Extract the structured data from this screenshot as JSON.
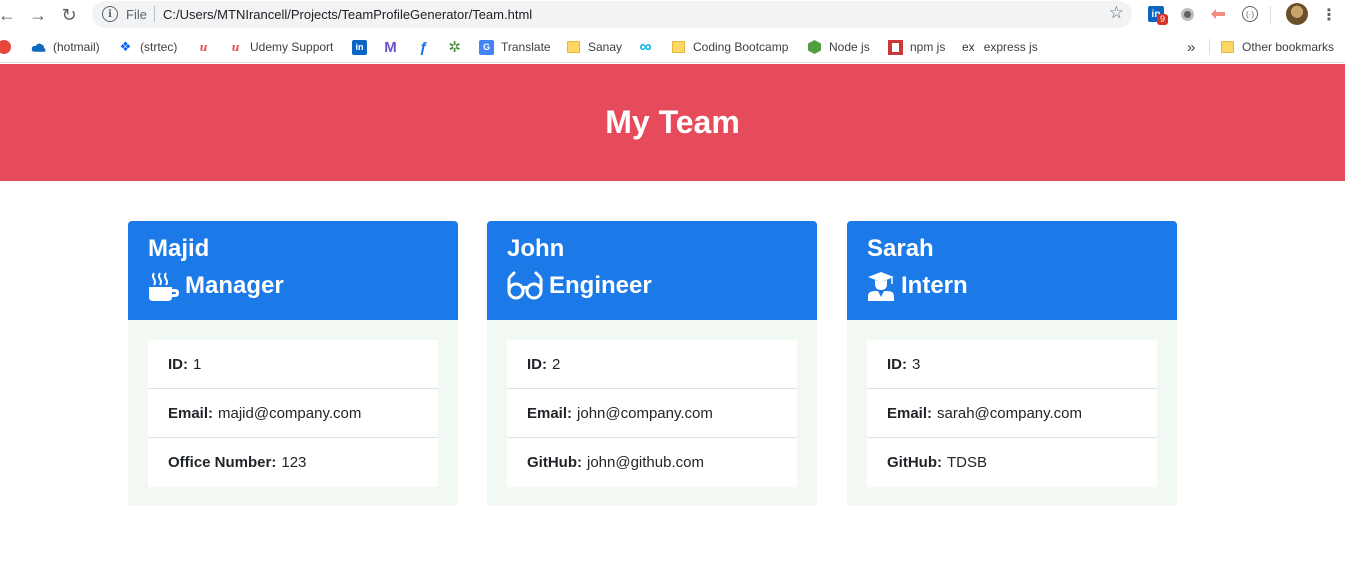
{
  "browser": {
    "omnibox_scheme": "File",
    "url": "C:/Users/MTNIrancell/Projects/TeamProfileGenerator/Team.html",
    "linkedin_badge": "9",
    "bookmarks": [
      "(hotmail)",
      "(strtec)",
      "Udemy Support",
      "Translate",
      "Sanay",
      "Coding Bootcamp",
      "Node js",
      "npm js",
      "express js"
    ],
    "other_bookmarks": "Other bookmarks",
    "more": "»"
  },
  "page": {
    "title": "My Team",
    "header_color": "#e54b5a",
    "card_header_color": "#1b7ae8"
  },
  "team": [
    {
      "name": "Majid",
      "role": "Manager",
      "role_icon": "mug-icon",
      "rows": [
        {
          "label": "ID:",
          "value": "1"
        },
        {
          "label": "Email:",
          "value": "majid@company.com"
        },
        {
          "label": "Office Number:",
          "value": "123"
        }
      ]
    },
    {
      "name": "John",
      "role": "Engineer",
      "role_icon": "glasses-icon",
      "rows": [
        {
          "label": "ID:",
          "value": "2"
        },
        {
          "label": "Email:",
          "value": "john@company.com"
        },
        {
          "label": "GitHub:",
          "value": "john@github.com"
        }
      ]
    },
    {
      "name": "Sarah",
      "role": "Intern",
      "role_icon": "graduate-icon",
      "rows": [
        {
          "label": "ID:",
          "value": "3"
        },
        {
          "label": "Email:",
          "value": "sarah@company.com"
        },
        {
          "label": "GitHub:",
          "value": "TDSB"
        }
      ]
    }
  ]
}
